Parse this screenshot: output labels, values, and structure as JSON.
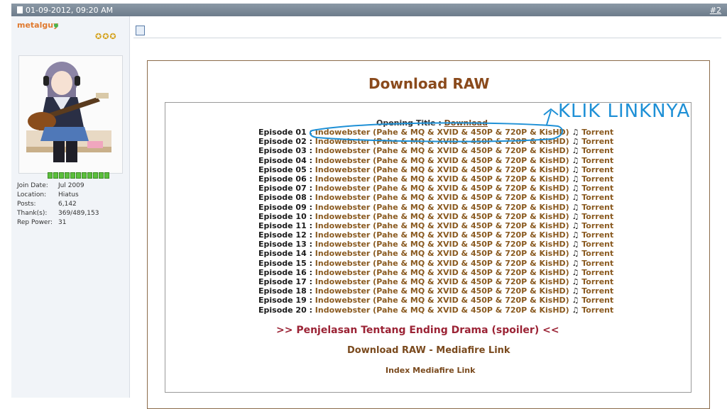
{
  "post": {
    "date": "01-09-2012, 09:20 AM",
    "number": "#2"
  },
  "user": {
    "name": "metalguy",
    "info": [
      {
        "label": "Join Date:",
        "value": "Jul 2009"
      },
      {
        "label": "Location:",
        "value": "Hiatus"
      },
      {
        "label": "Posts:",
        "value": "6,142"
      },
      {
        "label": "Thank(s):",
        "value": "369/489,153"
      },
      {
        "label": "Rep Power:",
        "value": "31"
      }
    ]
  },
  "content": {
    "title": "Download RAW",
    "opening_label": "Opening Title : ",
    "opening_link": "Download",
    "episodes": [
      {
        "label": "Episode 01 : ",
        "link": "Indowebster (Pahe & MQ & XVID & 450P & 720P & KisHD)",
        "note": " ♫ ",
        "torrent": "Torrent"
      },
      {
        "label": "Episode 02 : ",
        "link": "Indowebster (Pahe & MQ & XVID & 450P & 720P & KisHD)",
        "note": " ♫ ",
        "torrent": "Torrent"
      },
      {
        "label": "Episode 03 : ",
        "link": "Indowebster (Pahe & MQ & XVID & 450P & 720P & KisHD)",
        "note": " ♫ ",
        "torrent": "Torrent"
      },
      {
        "label": "Episode 04 : ",
        "link": "Indowebster (Pahe & MQ & XVID & 450P & 720P & KisHD)",
        "note": " ♫ ",
        "torrent": "Torrent"
      },
      {
        "label": "Episode 05 : ",
        "link": "Indowebster (Pahe & MQ & XVID & 450P & 720P & KisHD)",
        "note": " ♫ ",
        "torrent": "Torrent"
      },
      {
        "label": "Episode 06 : ",
        "link": "Indowebster (Pahe & MQ & XVID & 450P & 720P & KisHD)",
        "note": " ♫ ",
        "torrent": "Torrent"
      },
      {
        "label": "Episode 07 : ",
        "link": "Indowebster (Pahe & MQ & XVID & 450P & 720P & KisHD)",
        "note": " ♫ ",
        "torrent": "Torrent"
      },
      {
        "label": "Episode 08 : ",
        "link": "Indowebster (Pahe & MQ & XVID & 450P & 720P & KisHD)",
        "note": " ♫ ",
        "torrent": "Torrent"
      },
      {
        "label": "Episode 09 : ",
        "link": "Indowebster (Pahe & MQ & XVID & 450P & 720P & KisHD)",
        "note": " ♫ ",
        "torrent": "Torrent"
      },
      {
        "label": "Episode 10 : ",
        "link": "Indowebster (Pahe & MQ & XVID & 450P & 720P & KisHD)",
        "note": " ♫ ",
        "torrent": "Torrent"
      },
      {
        "label": "Episode 11 : ",
        "link": "Indowebster (Pahe & MQ & XVID & 450P & 720P & KisHD)",
        "note": " ♫ ",
        "torrent": "Torrent"
      },
      {
        "label": "Episode 12 : ",
        "link": "Indowebster (Pahe & MQ & XVID & 450P & 720P & KisHD)",
        "note": " ♫ ",
        "torrent": "Torrent"
      },
      {
        "label": "Episode 13 : ",
        "link": "Indowebster (Pahe & MQ & XVID & 450P & 720P & KisHD)",
        "note": " ♫ ",
        "torrent": "Torrent"
      },
      {
        "label": "Episode 14 : ",
        "link": "Indowebster (Pahe & MQ & XVID & 450P & 720P & KisHD)",
        "note": " ♫ ",
        "torrent": "Torrent"
      },
      {
        "label": "Episode 15 : ",
        "link": "Indowebster (Pahe & MQ & XVID & 450P & 720P & KisHD)",
        "note": " ♫ ",
        "torrent": "Torrent"
      },
      {
        "label": "Episode 16 : ",
        "link": "Indowebster (Pahe & MQ & XVID & 450P & 720P & KisHD)",
        "note": " ♫ ",
        "torrent": "Torrent"
      },
      {
        "label": "Episode 17 : ",
        "link": "Indowebster (Pahe & MQ & XVID & 450P & 720P & KisHD)",
        "note": " ♫ ",
        "torrent": "Torrent"
      },
      {
        "label": "Episode 18 : ",
        "link": "Indowebster (Pahe & MQ & XVID & 450P & 720P & KisHD)",
        "note": " ♫ ",
        "torrent": "Torrent"
      },
      {
        "label": "Episode 19 : ",
        "link": "Indowebster (Pahe & MQ & XVID & 450P & 720P & KisHD)",
        "note": " ♫ ",
        "torrent": "Torrent"
      },
      {
        "label": "Episode 20 : ",
        "link": "Indowebster (Pahe & MQ & XVID & 450P & 720P & KisHD)",
        "note": " ♫ ",
        "torrent": "Torrent"
      }
    ],
    "penjelasan": ">> Penjelasan Tentang Ending Drama (spoiler) <<",
    "mediafire": "Download RAW - Mediafire Link",
    "index_link": "Index Mediafire Link"
  },
  "annotation": {
    "text": "KLIK LINKNYA",
    "color": "#1e90d6"
  },
  "colors": {
    "header": "#7a8a99",
    "username": "#e07a2f",
    "title": "#8a4a1c",
    "link": "#8a5a20",
    "spoiler": "#9b2335"
  }
}
